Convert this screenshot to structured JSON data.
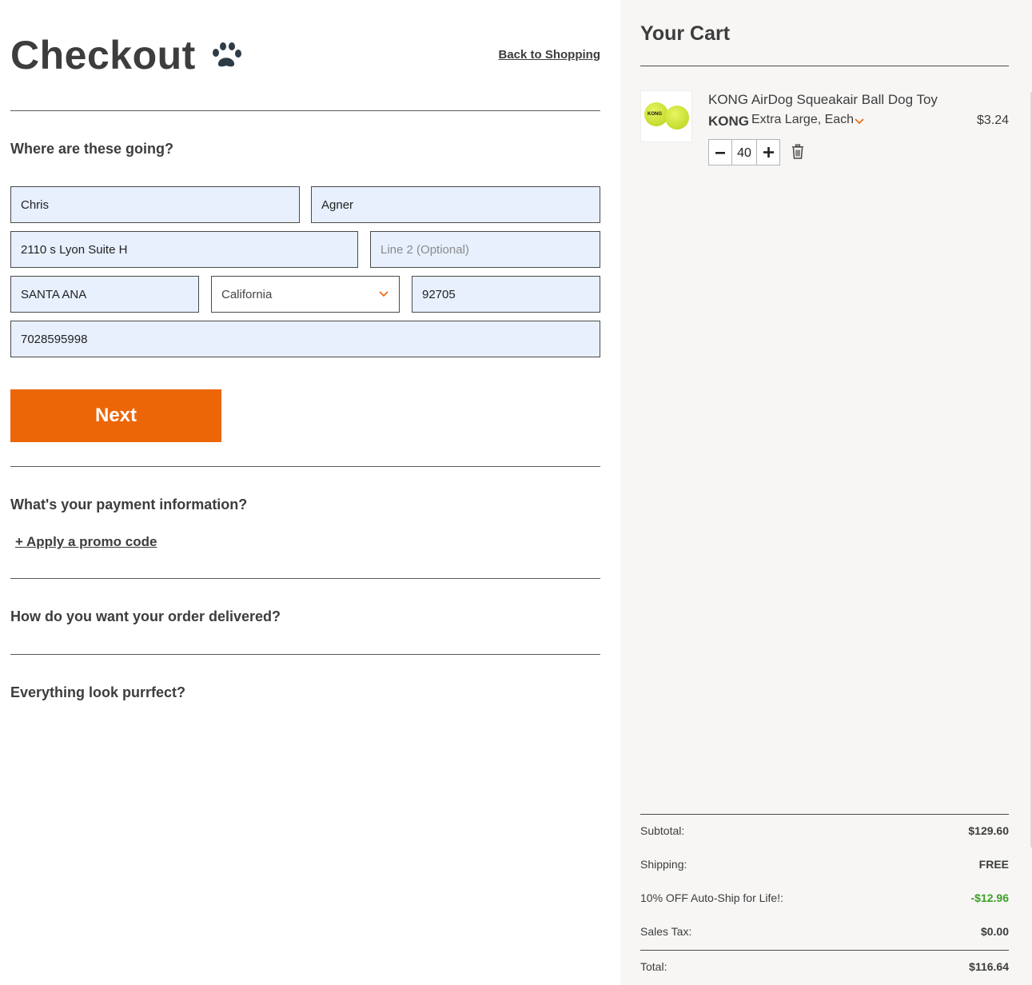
{
  "header": {
    "title": "Checkout",
    "back_link": "Back to Shopping"
  },
  "shipping": {
    "heading": "Where are these going?",
    "first_name": "Chris",
    "last_name": "Agner",
    "address_line1": "2110 s Lyon Suite H",
    "address_line2_placeholder": "Line 2 (Optional)",
    "city": "SANTA ANA",
    "state": "California",
    "zip": "92705",
    "phone": "7028595998",
    "next_label": "Next"
  },
  "payment": {
    "heading": "What's your payment information?",
    "promo_link": "+ Apply a promo code"
  },
  "delivery": {
    "heading": "How do you want your order delivered?"
  },
  "review": {
    "heading": "Everything look purrfect?"
  },
  "cart": {
    "title": "Your Cart",
    "items": [
      {
        "name": "KONG AirDog Squeakair Ball Dog Toy",
        "brand": "KONG",
        "variant": "Extra Large, Each",
        "price": "$3.24",
        "quantity": "40",
        "thumb_label": "KONG"
      }
    ],
    "summary": {
      "subtotal_label": "Subtotal:",
      "subtotal": "$129.60",
      "shipping_label": "Shipping:",
      "shipping": "FREE",
      "discount_label": "10% OFF Auto-Ship for Life!:",
      "discount": "-$12.96",
      "tax_label": "Sales Tax:",
      "tax": "$0.00",
      "total_label": "Total:",
      "total": "$116.64"
    }
  },
  "icons": {
    "paw": "paw-icon",
    "chevron": "chevron-down-icon",
    "minus": "minus-icon",
    "plus": "plus-icon",
    "trash": "trash-icon"
  },
  "colors": {
    "accent": "#ec6608",
    "input_bg": "#e8f0fe",
    "discount": "#3aa024",
    "sidebar_bg": "#f7f6f5"
  }
}
